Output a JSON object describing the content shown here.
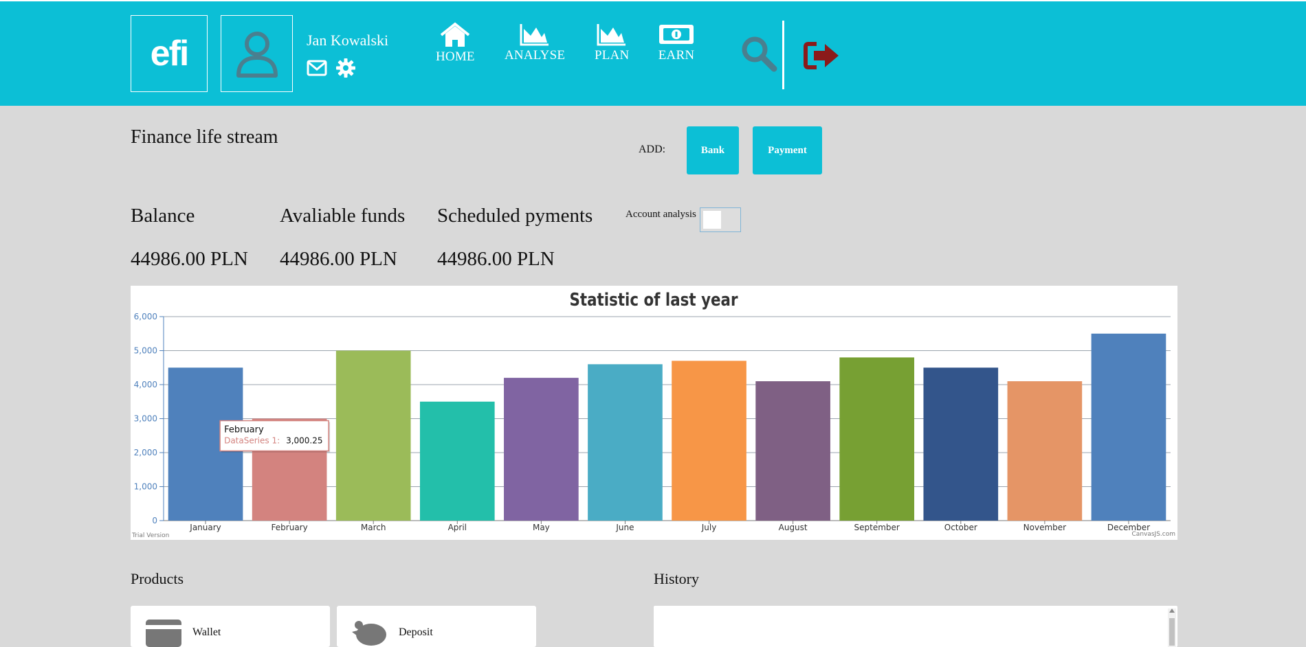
{
  "header": {
    "logo_text": "efi",
    "username": "Jan Kowalski",
    "nav": [
      {
        "label": "HOME",
        "icon": "home-icon"
      },
      {
        "label": "ANALYSE",
        "icon": "area-chart-icon"
      },
      {
        "label": "PLAN",
        "icon": "area-chart-icon"
      },
      {
        "label": "EARN",
        "icon": "money-icon"
      }
    ],
    "colors": {
      "bar": "#0cbfd6",
      "icon_dark": "#4a7f8f",
      "logout": "#8b1a1a"
    }
  },
  "main": {
    "title": "Finance life stream",
    "add_label": "ADD:",
    "add_buttons": [
      "Bank",
      "Payment"
    ],
    "kpis": [
      {
        "label": "Balance",
        "value": "44986.00 PLN"
      },
      {
        "label": "Avaliable funds",
        "value": "44986.00 PLN"
      },
      {
        "label": "Scheduled pyments",
        "value": "44986.00 PLN"
      }
    ],
    "account_analysis_label": "Account analysis",
    "account_analysis_on": false
  },
  "chart_data": {
    "type": "bar",
    "title": "Statistic of last year",
    "categories": [
      "January",
      "February",
      "March",
      "April",
      "May",
      "June",
      "July",
      "August",
      "September",
      "October",
      "November",
      "December"
    ],
    "values": [
      4500,
      3000.25,
      5000,
      3500,
      4200,
      4600,
      4700,
      4100,
      4800,
      4500,
      4100,
      5500
    ],
    "colors": [
      "#4f81bc",
      "#d3837f",
      "#9bbb59",
      "#23bfaa",
      "#8064a2",
      "#4aacc5",
      "#f79647",
      "#7f6084",
      "#77a033",
      "#33558b",
      "#e59566",
      "#4f81bc"
    ],
    "ylim": [
      0,
      6000
    ],
    "yticks": [
      "0",
      "1,000",
      "2,000",
      "3,000",
      "4,000",
      "5,000",
      "6,000"
    ],
    "grid": true,
    "tooltip": {
      "category": "February",
      "series": "DataSeries 1:",
      "value": "3,000.25"
    },
    "footer_left": "Trial Version",
    "footer_right": "CanvasJS.com"
  },
  "bottom": {
    "products_title": "Products",
    "history_title": "History",
    "cards": [
      "Wallet",
      "Deposit"
    ]
  }
}
